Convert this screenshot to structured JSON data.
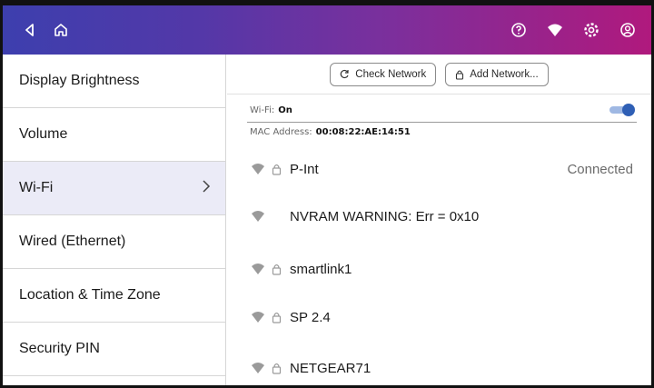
{
  "header": {
    "back_icon": "back-triangle-icon",
    "home_icon": "home-icon",
    "right_icons": [
      "help-icon",
      "wifi-icon",
      "settings-icon",
      "account-icon"
    ],
    "gradient": [
      "#3d3fae",
      "#b0197d"
    ]
  },
  "sidebar": {
    "items": [
      {
        "label": "Display Brightness"
      },
      {
        "label": "Volume"
      },
      {
        "label": "Wi-Fi",
        "active": true
      },
      {
        "label": "Wired (Ethernet)"
      },
      {
        "label": "Location & Time Zone"
      },
      {
        "label": "Security PIN"
      }
    ]
  },
  "toolbar": {
    "check_network_label": "Check Network",
    "add_network_label": "Add Network..."
  },
  "wifi": {
    "label": "Wi-Fi:",
    "state": "On",
    "mac_label": "MAC Address:",
    "mac_value": "00:08:22:AE:14:51"
  },
  "networks": [
    {
      "name": "P-Int",
      "locked": true,
      "status": "Connected"
    },
    {
      "name": "NVRAM WARNING: Err = 0x10",
      "locked": false,
      "status": ""
    },
    {
      "name": "smartlink1",
      "locked": true,
      "status": ""
    },
    {
      "name": "SP 2.4",
      "locked": true,
      "status": ""
    },
    {
      "name": "NETGEAR71",
      "locked": true,
      "status": ""
    }
  ],
  "colors": {
    "accent": "#2f5fb5",
    "active_row": "#ebebf7"
  }
}
